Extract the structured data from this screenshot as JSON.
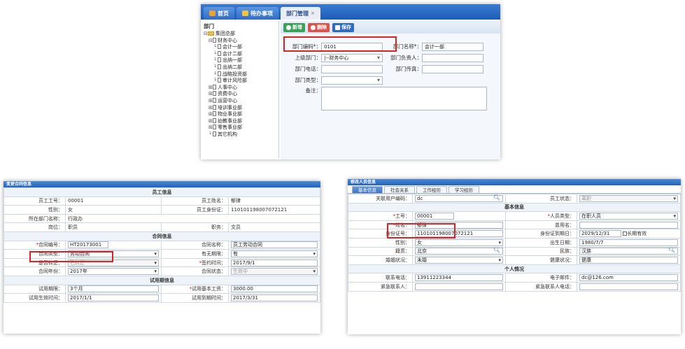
{
  "top": {
    "tabs": [
      {
        "label": "首页"
      },
      {
        "label": "待办事项"
      },
      {
        "label": "部门管理"
      }
    ],
    "tree": {
      "title": "部门",
      "items": [
        {
          "label": "集团总部",
          "pm": "⊟",
          "lvl": 0,
          "folder": true
        },
        {
          "label": "财务中心",
          "pm": "⊟",
          "lvl": 1
        },
        {
          "label": "会计一部",
          "pm": "",
          "lvl": 2
        },
        {
          "label": "会计二部",
          "pm": "",
          "lvl": 2
        },
        {
          "label": "出纳一部",
          "pm": "",
          "lvl": 2
        },
        {
          "label": "出纳二部",
          "pm": "",
          "lvl": 2
        },
        {
          "label": "战略投资部",
          "pm": "",
          "lvl": 2
        },
        {
          "label": "审计风险部",
          "pm": "",
          "lvl": 2
        },
        {
          "label": "人事中心",
          "pm": "⊞",
          "lvl": 1
        },
        {
          "label": "资费中心",
          "pm": "⊞",
          "lvl": 1
        },
        {
          "label": "运营中心",
          "pm": "⊞",
          "lvl": 1
        },
        {
          "label": "培训事业部",
          "pm": "⊞",
          "lvl": 1
        },
        {
          "label": "物业事业部",
          "pm": "⊞",
          "lvl": 1
        },
        {
          "label": "幼教事业部",
          "pm": "⊞",
          "lvl": 1
        },
        {
          "label": "零售事业部",
          "pm": "⊞",
          "lvl": 1
        },
        {
          "label": "其它机构",
          "pm": "",
          "lvl": 1
        }
      ]
    },
    "toolbar": {
      "add": "新增",
      "del": "删除",
      "save": "保存"
    },
    "form": {
      "code_label": "部门编码*：",
      "code": "0101",
      "name_label": "部门名称*：",
      "name": "会计一部",
      "parent_label": "上级部门：",
      "parent": "|--财务中心",
      "leader_label": "部门负责人：",
      "leader": "",
      "phone_label": "部门电话：",
      "phone": "",
      "fax_label": "部门传真：",
      "fax": "",
      "type_label": "部门类型：",
      "type": "",
      "remark_label": "备注：",
      "remark": ""
    }
  },
  "contract": {
    "title": "变更合同信息",
    "sec_emp": "员工信息",
    "emp_no_l": "员工工号：",
    "emp_no": "00001",
    "emp_name_l": "员工姓名：",
    "emp_name": "郁律",
    "gender_l": "性别：",
    "gender": "女",
    "idcard_l": "员工身份证：",
    "idcard": "110101198007072121",
    "dept_l": "所在部门名称：",
    "dept": "行政办",
    "post_l": "岗位：",
    "post": "职员",
    "duty_l": "职务：",
    "duty": "文员",
    "sec_con": "合同信息",
    "con_no_l": "合同编号：",
    "con_no": "HT20173001",
    "con_name_l": "合同名称：",
    "con_name": "员工劳动合同",
    "con_type_l": "合同类型：",
    "con_type": "劳动合同",
    "fixed_l": "有无期限：",
    "fixed": "有",
    "regular_l": "是否转正：",
    "regular": "已转正",
    "sign_l": "签约时间：",
    "sign": "2017/9/1",
    "year_l": "合同年份：",
    "year": "2017年",
    "status_l": "合同状态：",
    "status": "生效中",
    "sec_trial": "试用期信息",
    "trial_l": "试用期限：",
    "trial": "3个月",
    "salary_l": "试用基本工资：",
    "salary": "3000.00",
    "start_l": "试用生效时间：",
    "start": "2017/1/1",
    "end_l": "试用到期时间：",
    "end": "2017/3/31"
  },
  "person": {
    "title": "修改人员信息",
    "tabs": [
      "基本信息",
      "社会关系",
      "工作经历",
      "学习经历"
    ],
    "acct_l": "关联用户编码：",
    "acct": "dc",
    "state_l": "员工状态：",
    "state": "离职",
    "sec_basic": "基本信息",
    "no_l": "工号：",
    "no": "00001",
    "ptype_l": "人员类型：",
    "ptype": "在职人员",
    "name_l": "姓名：",
    "name": "郁律",
    "alias_l": "曾用名：",
    "alias": "",
    "id_l": "身份证号：",
    "id": "110101198007072121",
    "idexp_l": "身份证到期日：",
    "idexp": "2029/12/31",
    "longterm": "长期有效",
    "sex_l": "性别：",
    "sex": "女",
    "birth_l": "出生日期：",
    "birth": "1980/7/7",
    "native_l": "籍贯：",
    "native": "北京",
    "nation_l": "民族：",
    "nation": "汉族",
    "marry_l": "婚姻状况：",
    "marry": "未婚",
    "health_l": "健康状况：",
    "health": "健康",
    "sec_personal": "个人情况",
    "tel_l": "联系电话：",
    "tel": "13911223344",
    "mail_l": "电子邮件：",
    "mail": "dc@126.com",
    "ec_l": "紧急联系人：",
    "ec": "",
    "ectel_l": "紧急联系人电话：",
    "ectel": ""
  },
  "colors": {
    "header": "#2563b8",
    "highlight": "#dd2222",
    "add": "#3da05a",
    "del": "#d9534f",
    "save": "#2f6bc2"
  }
}
